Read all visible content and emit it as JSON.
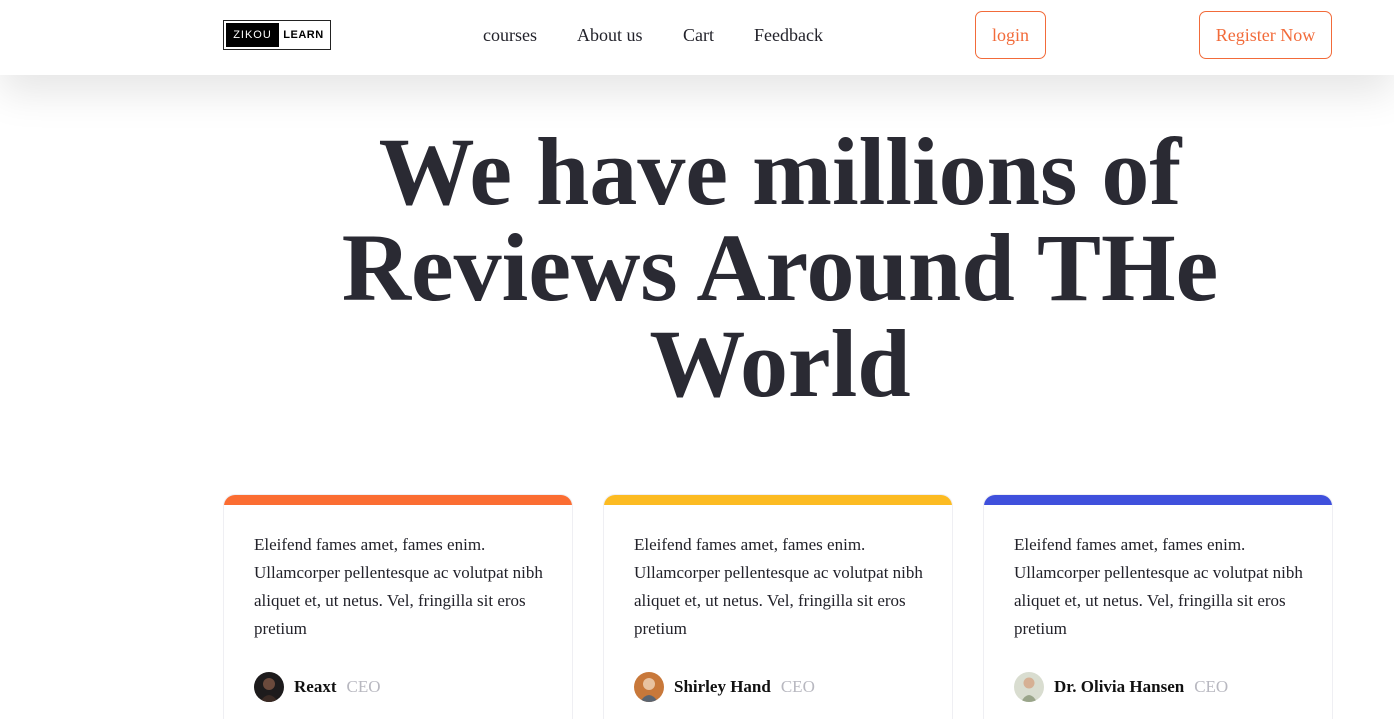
{
  "header": {
    "logo_left": "ZIKOU",
    "logo_right": "LEARN",
    "nav": [
      "courses",
      "About us",
      "Cart",
      "Feedback"
    ],
    "login_label": "login",
    "register_label": "Register Now"
  },
  "hero": {
    "line1": "We have millions of",
    "line2": "Reviews Around THe",
    "line3": "World"
  },
  "colors": {
    "accent": "#f26b3a",
    "card_bars": [
      "#fb6d32",
      "#fcbb22",
      "#3f50dc"
    ]
  },
  "reviews": [
    {
      "text": "Eleifend fames amet, fames enim. Ullamcorper pellentesque ac volutpat nibh aliquet et, ut netus. Vel, fringilla sit eros pretium",
      "name": "Reaxt",
      "role": "CEO"
    },
    {
      "text": "Eleifend fames amet, fames enim. Ullamcorper pellentesque ac volutpat nibh aliquet et, ut netus. Vel, fringilla sit eros pretium",
      "name": "Shirley Hand",
      "role": "CEO"
    },
    {
      "text": "Eleifend fames amet, fames enim. Ullamcorper pellentesque ac volutpat nibh aliquet et, ut netus. Vel, fringilla sit eros pretium",
      "name": "Dr. Olivia Hansen",
      "role": "CEO"
    }
  ]
}
